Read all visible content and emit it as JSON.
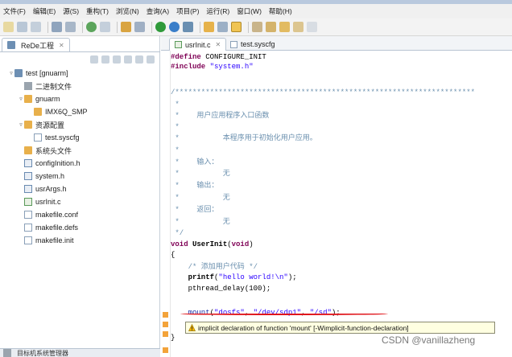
{
  "menu": [
    "文件(F)",
    "编辑(E)",
    "源(S)",
    "重构(T)",
    "浏览(N)",
    "查询(A)",
    "项目(P)",
    "运行(R)",
    "窗口(W)",
    "帮助(H)"
  ],
  "explorer": {
    "tab_label": "ReDe工程",
    "tree": [
      {
        "label": "test [gnuarm]",
        "indent": 0,
        "arrow": "▿",
        "icon": "project"
      },
      {
        "label": "二进制文件",
        "indent": 1,
        "arrow": "",
        "icon": "bin"
      },
      {
        "label": "gnuarm",
        "indent": 1,
        "arrow": "▿",
        "icon": "folder"
      },
      {
        "label": "IMX6Q_SMP",
        "indent": 2,
        "arrow": "",
        "icon": "folder"
      },
      {
        "label": "资源配置",
        "indent": 1,
        "arrow": "▿",
        "icon": "folder"
      },
      {
        "label": "test.syscfg",
        "indent": 2,
        "arrow": "",
        "icon": "file"
      },
      {
        "label": "系统头文件",
        "indent": 1,
        "arrow": "",
        "icon": "folder"
      },
      {
        "label": "configInition.h",
        "indent": 1,
        "arrow": "",
        "icon": "hfile"
      },
      {
        "label": "system.h",
        "indent": 1,
        "arrow": "",
        "icon": "hfile"
      },
      {
        "label": "usrArgs.h",
        "indent": 1,
        "arrow": "",
        "icon": "hfile"
      },
      {
        "label": "usrInit.c",
        "indent": 1,
        "arrow": "",
        "icon": "cfile"
      },
      {
        "label": "makefile.conf",
        "indent": 1,
        "arrow": "",
        "icon": "file"
      },
      {
        "label": "makefile.defs",
        "indent": 1,
        "arrow": "",
        "icon": "file"
      },
      {
        "label": "makefile.init",
        "indent": 1,
        "arrow": "",
        "icon": "file"
      }
    ],
    "bottom_tab": "目标机系统管理器"
  },
  "editor": {
    "tabs": [
      {
        "label": "usrInit.c",
        "active": true
      },
      {
        "label": "test.syscfg",
        "active": false
      }
    ],
    "code": {
      "define_kw": "#define",
      "define_val": " CONFIGURE_INIT",
      "include_kw": "#include",
      "include_val": " \"system.h\"",
      "comment_top": "/*********************************************************************",
      "star": " *",
      "c_title": " *    用户应用程序入口函数",
      "c_desc": " *          本程序用于初始化用户应用。",
      "c_input": " *    输入：",
      "c_none": " *          无",
      "c_output": " *    输出：",
      "c_return": " *    返回：",
      "comment_end": " */",
      "fn_type": "void",
      "fn_name": " UserInit",
      "fn_paren_open": "(",
      "fn_param": "void",
      "fn_paren_close": ")",
      "brace_open": "{",
      "body_comment": "    /* 添加用户代码 */",
      "printf_name": "    printf",
      "printf_args_open": "(",
      "printf_str": "\"hello world!\\n\"",
      "printf_args_close": ");",
      "delay_call": "    pthread_delay(100);",
      "mount_name": "    mount",
      "mount_open": "(",
      "mount_arg1": "\"dosfs\"",
      "mount_sep1": ", ",
      "mount_arg2": "\"/dev/sdp1\"",
      "mount_sep2": ", ",
      "mount_arg3": "\"/sd\"",
      "mount_close": ");",
      "brace_close": "}"
    },
    "tooltip": {
      "text": "implicit declaration of function    'mount'    [-Wimplicit-function-declaration]"
    }
  },
  "watermark": "CSDN @vanillazheng",
  "colors": {
    "keyword": "#7f0055",
    "string": "#2a00ff",
    "comment": "#3f7f5f",
    "error": "#e0151b",
    "tooltip_bg": "#ffffe1"
  }
}
